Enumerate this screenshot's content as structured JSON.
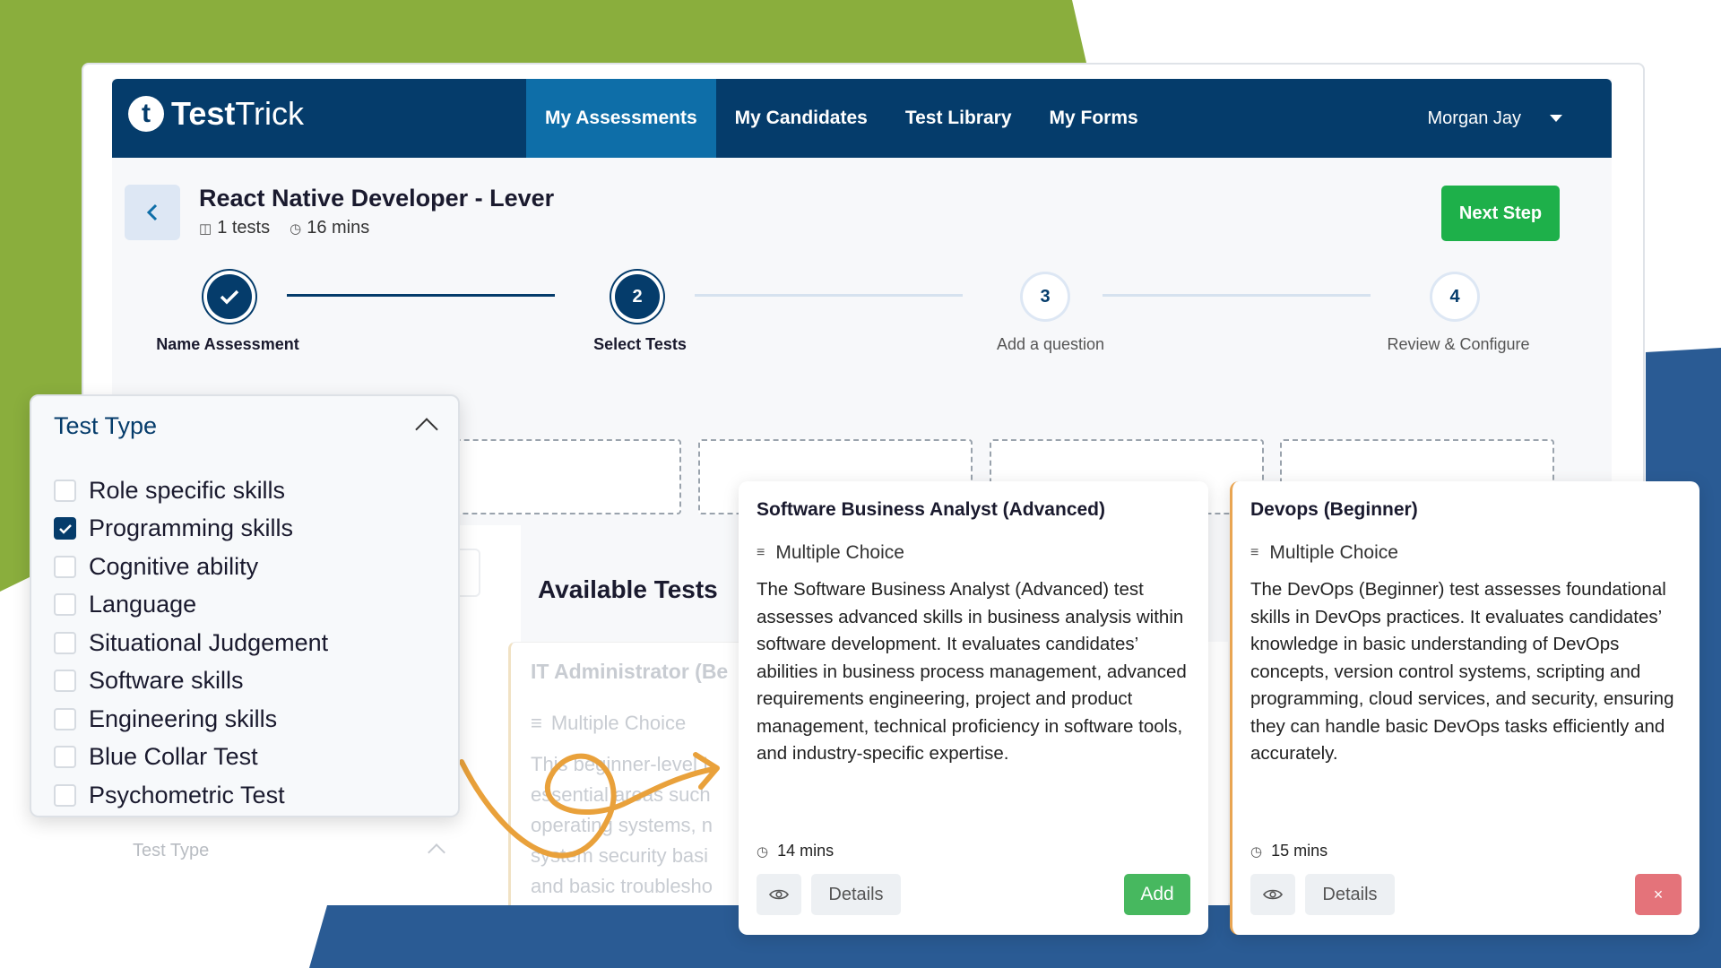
{
  "brand": {
    "logo_letter": "t",
    "name_bold": "Test",
    "name_regular": "Trick"
  },
  "nav": {
    "tabs": [
      {
        "label": "My Assessments",
        "active": true
      },
      {
        "label": "My Candidates",
        "active": false
      },
      {
        "label": "Test Library",
        "active": false
      },
      {
        "label": "My Forms",
        "active": false
      }
    ],
    "user": "Morgan Jay"
  },
  "assessment": {
    "title": "React Native Developer - Lever",
    "tests_count": "1 tests",
    "duration": "16 mins",
    "next_label": "Next Step"
  },
  "steps": [
    {
      "number": "",
      "label": "Name Assessment",
      "status": "done"
    },
    {
      "number": "2",
      "label": "Select Tests",
      "status": "current"
    },
    {
      "number": "3",
      "label": "Add a question",
      "status": "pending"
    },
    {
      "number": "4",
      "label": "Review & Configure",
      "status": "pending"
    }
  ],
  "available_title": "Available Tests",
  "faded": {
    "filter_label": "Test Type",
    "card_title": "IT Administrator (Be",
    "card_type": "Multiple Choice",
    "card_desc": [
      "This beginner-level I",
      "essential areas such",
      "operating systems, n",
      "system security basi",
      "and basic troublesho"
    ]
  },
  "filter": {
    "title": "Test Type",
    "items": [
      {
        "label": "Role specific skills",
        "checked": false
      },
      {
        "label": "Programming skills",
        "checked": true
      },
      {
        "label": "Cognitive ability",
        "checked": false
      },
      {
        "label": "Language",
        "checked": false
      },
      {
        "label": "Situational Judgement",
        "checked": false
      },
      {
        "label": "Software skills",
        "checked": false
      },
      {
        "label": "Engineering skills",
        "checked": false
      },
      {
        "label": "Blue Collar Test",
        "checked": false
      },
      {
        "label": "Psychometric Test",
        "checked": false
      }
    ]
  },
  "cards": [
    {
      "title": "Software Business Analyst (Advanced)",
      "type": "Multiple Choice",
      "description": "The Software Business Analyst (Advanced) test assesses advanced skills in business analysis within software development. It evaluates candidates’ abilities in business process management, advanced requirements engineering, project and product management, technical proficiency in software tools, and industry-specific expertise.",
      "time": "14 mins",
      "details_label": "Details",
      "action_label": "Add"
    },
    {
      "title": "Devops (Beginner)",
      "type": "Multiple Choice",
      "description": "The DevOps (Beginner) test assesses foundational skills in DevOps practices. It evaluates candidates’ knowledge in basic understanding of DevOps concepts, version control systems, scripting and programming, cloud services, and security, ensuring they can handle basic DevOps tasks efficiently and accurately.",
      "time": "15 mins",
      "details_label": "Details",
      "action_label": "×"
    }
  ],
  "colors": {
    "navy": "#053c6b",
    "green": "#1eb04a",
    "accent_orange": "#e9a552",
    "bg_green": "#8aae3d",
    "bg_blue": "#2a5b94"
  }
}
